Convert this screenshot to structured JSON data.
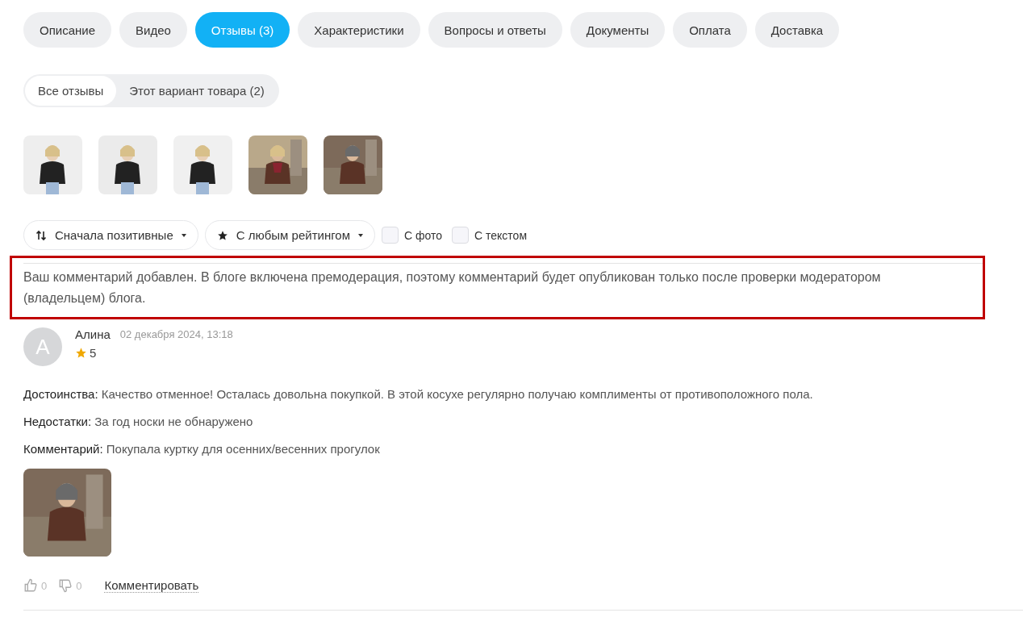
{
  "tabs": [
    {
      "label": "Описание",
      "selected": false
    },
    {
      "label": "Видео",
      "selected": false
    },
    {
      "label": "Отзывы (3)",
      "selected": true
    },
    {
      "label": "Характеристики",
      "selected": false
    },
    {
      "label": "Вопросы и ответы",
      "selected": false
    },
    {
      "label": "Документы",
      "selected": false
    },
    {
      "label": "Оплата",
      "selected": false
    },
    {
      "label": "Доставка",
      "selected": false
    }
  ],
  "subtabs": [
    {
      "label": "Все отзывы",
      "selected": true
    },
    {
      "label": "Этот вариант товара (2)",
      "selected": false
    }
  ],
  "filters": {
    "sort": "Сначала позитивные",
    "rating": "С любым рейтингом",
    "checks": [
      {
        "label": "С фото",
        "checked": false
      },
      {
        "label": "С текстом",
        "checked": false
      }
    ]
  },
  "notice": "Ваш комментарий добавлен. В блоге включена премодерация, поэтому комментарий будет опубликован только после проверки модератором (владельцем) блога.",
  "review": {
    "avatar": "А",
    "author": "Алина",
    "date": "02 декабря 2024, 13:18",
    "rating": "5",
    "sections": [
      {
        "label": "Достоинства:",
        "text": "Качество отменное! Осталась довольна покупкой. В этой косухе регулярно получаю комплименты от противоположного пола."
      },
      {
        "label": "Недостатки:",
        "text": "За год носки не обнаружено"
      },
      {
        "label": "Комментарий:",
        "text": "Покупала куртку для осенних/весенних прогулок"
      }
    ],
    "likes": "0",
    "dislikes": "0",
    "comment_link": "Комментировать"
  }
}
